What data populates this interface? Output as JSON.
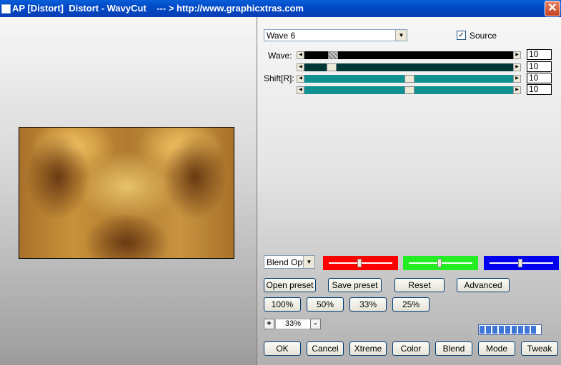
{
  "window": {
    "title": "AP [Distort]  Distort - WavyCut    --- > http://www.graphicxtras.com",
    "close_glyph": "✕"
  },
  "preset_select": {
    "value": "Wave 6"
  },
  "source_checkbox": {
    "label": "Source",
    "checked": true
  },
  "params": [
    {
      "label": "Wave:",
      "value": "10"
    },
    {
      "label": "",
      "value": "10"
    },
    {
      "label": "Shift[R]:",
      "value": "10"
    },
    {
      "label": "",
      "value": "10"
    }
  ],
  "blend_select": {
    "value": "Blend Optio"
  },
  "colors": {
    "red": "#ff0000",
    "green": "#22ee22",
    "blue": "#0000ee",
    "teal": "#109090",
    "dark_teal": "#003838"
  },
  "buttons_row1": [
    "Open preset",
    "Save preset",
    "Reset",
    "Advanced"
  ],
  "zoom_buttons": [
    "100%",
    "50%",
    "33%",
    "25%"
  ],
  "zoom": {
    "minus": "-",
    "plus": "+",
    "value": "33%"
  },
  "progress": {
    "segments_filled": 9,
    "segments_total": 9
  },
  "bottom_buttons": [
    "OK",
    "Cancel",
    "Xtreme",
    "Color",
    "Blend",
    "Mode",
    "Tweak"
  ]
}
